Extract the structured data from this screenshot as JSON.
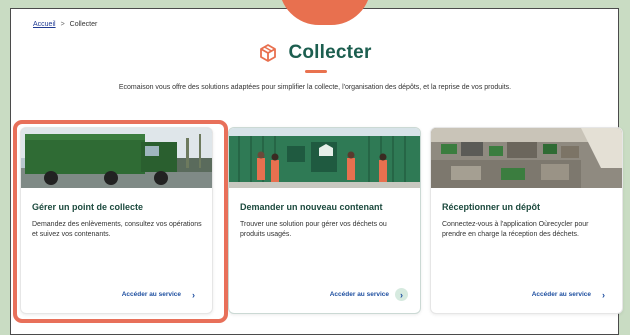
{
  "breadcrumb": {
    "home": "Accueil",
    "separator": ">",
    "current": "Collecter"
  },
  "header": {
    "title": "Collecter",
    "icon": "box-icon",
    "intro": "Ecomaison vous offre des solutions adaptées pour simplifier la collecte, l'organisation des dépôts, et la reprise de vos produits."
  },
  "cards": [
    {
      "title": "Gérer un point de collecte",
      "description": "Demandez des enlèvements, consultez vos opérations et suivez vos contenants.",
      "cta": "Accéder au service",
      "image": "truck-photo"
    },
    {
      "title": "Demander un nouveau contenant",
      "description": "Trouver une solution pour gérer vos déchets ou produits usagés.",
      "cta": "Accéder au service",
      "image": "container-team-photo"
    },
    {
      "title": "Réceptionner un dépôt",
      "description": "Connectez-vous à l'application Oùrecycler pour prendre en charge la réception des déchets.",
      "cta": "Accéder au service",
      "image": "warehouse-photo"
    }
  ],
  "colors": {
    "accent": "#e8704f",
    "title": "#1c5e4f",
    "link": "#1e4fa0",
    "page_background": "#c9dcc3"
  }
}
